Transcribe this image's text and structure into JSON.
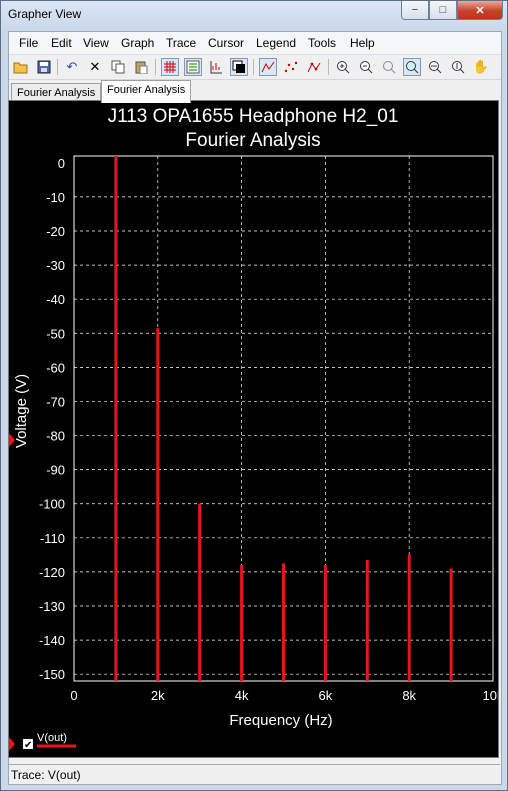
{
  "window": {
    "title": "Grapher View",
    "minimize": "−",
    "maximize": "□",
    "close": "✕"
  },
  "menu": [
    "File",
    "Edit",
    "View",
    "Graph",
    "Trace",
    "Cursor",
    "Legend",
    "Tools",
    "Help"
  ],
  "toolbar": {
    "icons": [
      "open-icon",
      "save-icon",
      "undo-icon",
      "cut-icon",
      "copy-icon",
      "paste-icon",
      "grid-icon",
      "legend-icon",
      "axis-icon",
      "invert-colors-icon",
      "line-plot-icon",
      "dot-plot-icon",
      "line-dot-plot-icon",
      "zoom-in-icon",
      "zoom-out-icon",
      "zoom-full-icon",
      "zoom-area-icon",
      "zoom-x-icon",
      "zoom-y-icon",
      "pan-icon"
    ]
  },
  "tabs": [
    "Fourier Analysis",
    "Fourier Analysis"
  ],
  "active_tab": 1,
  "legend": {
    "label": "V(out)",
    "checked": true,
    "color": "#e8141c"
  },
  "status": {
    "text": "Trace: V(out)"
  },
  "chart_data": {
    "type": "bar",
    "title": "J113 OPA1655 Headphone H2_01",
    "subtitle": "Fourier Analysis",
    "xlabel": "Frequency (Hz)",
    "ylabel": "Voltage (V)",
    "xlim": [
      0,
      10000
    ],
    "ylim": [
      -152,
      2
    ],
    "x_ticks": [
      0,
      2000,
      4000,
      6000,
      8000,
      10000
    ],
    "x_tick_labels": [
      "0",
      "2k",
      "4k",
      "6k",
      "8k",
      "10k"
    ],
    "y_ticks": [
      0,
      -10,
      -20,
      -30,
      -40,
      -50,
      -60,
      -70,
      -80,
      -90,
      -100,
      -110,
      -120,
      -130,
      -140,
      -150
    ],
    "grid": true,
    "background": "#000000",
    "series": [
      {
        "name": "V(out)",
        "color": "#e8141c",
        "x": [
          1000,
          2000,
          3000,
          4000,
          5000,
          6000,
          7000,
          8000,
          9000
        ],
        "values": [
          2,
          -48.5,
          -100,
          -118,
          -117.5,
          -118,
          -116.5,
          -115,
          -119
        ]
      }
    ]
  }
}
